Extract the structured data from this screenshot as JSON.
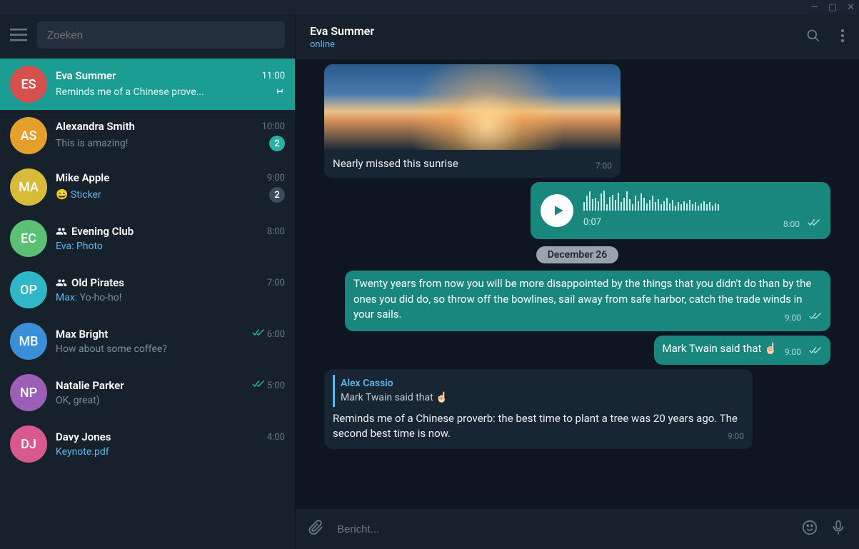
{
  "window": {
    "minimize": "—",
    "maximize": "▢",
    "close": "✕"
  },
  "search": {
    "placeholder": "Zoeken"
  },
  "chats": [
    {
      "initials": "ES",
      "color": "#d5514e",
      "name": "Eva Summer",
      "time": "11:00",
      "preview": "Reminds me of a Chinese prove...",
      "active": true,
      "pinned": true
    },
    {
      "initials": "AS",
      "color": "#e5a02b",
      "name": "Alexandra Smith",
      "time": "10:00",
      "preview": "This is amazing!",
      "badge": "2",
      "badgeClass": ""
    },
    {
      "initials": "MA",
      "color": "#d9bb3a",
      "name": "Mike Apple",
      "time": "9:00",
      "preview": "😄 ",
      "special": "Sticker",
      "badge": "2",
      "badgeClass": "muted"
    },
    {
      "initials": "EC",
      "color": "#5bbf74",
      "name": "Evening Club",
      "time": "8:00",
      "preview": "",
      "sender": "Eva:",
      "special": " Photo",
      "group": true
    },
    {
      "initials": "OP",
      "color": "#2fb7c8",
      "name": "Old Pirates",
      "time": "7:00",
      "preview": " Yo-ho-ho!",
      "sender": "Max:",
      "group": true
    },
    {
      "initials": "MB",
      "color": "#3a8fd8",
      "name": "Max Bright",
      "time": "6:00",
      "preview": "How about some coffee?",
      "checks": true
    },
    {
      "initials": "NP",
      "color": "#9c5fb7",
      "name": "Natalie Parker",
      "time": "5:00",
      "preview": "OK, great)",
      "checks": true
    },
    {
      "initials": "DJ",
      "color": "#d85a8c",
      "name": "Davy Jones",
      "time": "4:00",
      "preview": "",
      "special": "Keynote.pdf"
    }
  ],
  "header": {
    "name": "Eva Summer",
    "status": "online"
  },
  "messages": {
    "img_caption": "Nearly missed this sunrise",
    "img_time": "7:00",
    "voice_dur": "0:07",
    "voice_time": "8:00",
    "date": "December 26",
    "quote": "Twenty years from now you will be more disappointed by the things that you didn't do than by the ones you did do, so throw off the bowlines, sail away from safe harbor, catch the trade winds in your sails.",
    "quote_time": "9:00",
    "twain": "Mark Twain said that ☝🏻",
    "twain_time": "9:00",
    "reply_name": "Alex Cassio",
    "reply_quote": "Mark Twain said that ☝🏻",
    "proverb": "Reminds me of a Chinese proverb: the best time to plant a tree was 20 years ago. The second best time is now.",
    "proverb_time": "9:00"
  },
  "input": {
    "placeholder": "Bericht..."
  }
}
